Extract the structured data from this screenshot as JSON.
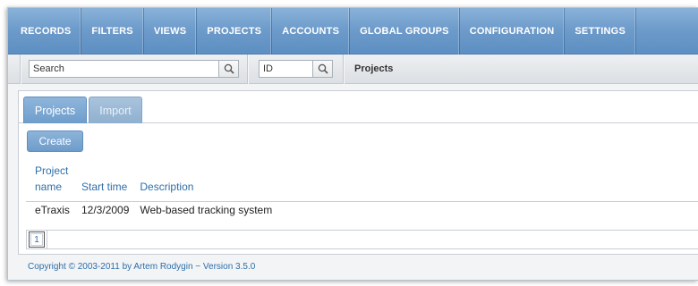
{
  "nav": {
    "items": [
      "RECORDS",
      "FILTERS",
      "VIEWS",
      "PROJECTS",
      "ACCOUNTS",
      "GLOBAL GROUPS",
      "CONFIGURATION",
      "SETTINGS"
    ]
  },
  "toolbar": {
    "search_placeholder": "Search",
    "id_placeholder": "ID",
    "breadcrumb": "Projects"
  },
  "tabs": [
    {
      "label": "Projects",
      "active": true
    },
    {
      "label": "Import",
      "active": false
    }
  ],
  "create_label": "Create",
  "table": {
    "headers": [
      "Project name",
      "Start time",
      "Description"
    ],
    "rows": [
      [
        "eTraxis",
        "12/3/2009",
        "Web-based tracking system"
      ]
    ]
  },
  "pager": {
    "current": "1"
  },
  "footer": "Copyright © 2003-2011 by Artem Rodygin − Version 3.5.0",
  "colors": {
    "accent": "#6e9ccb",
    "link": "#2e6fa8"
  }
}
